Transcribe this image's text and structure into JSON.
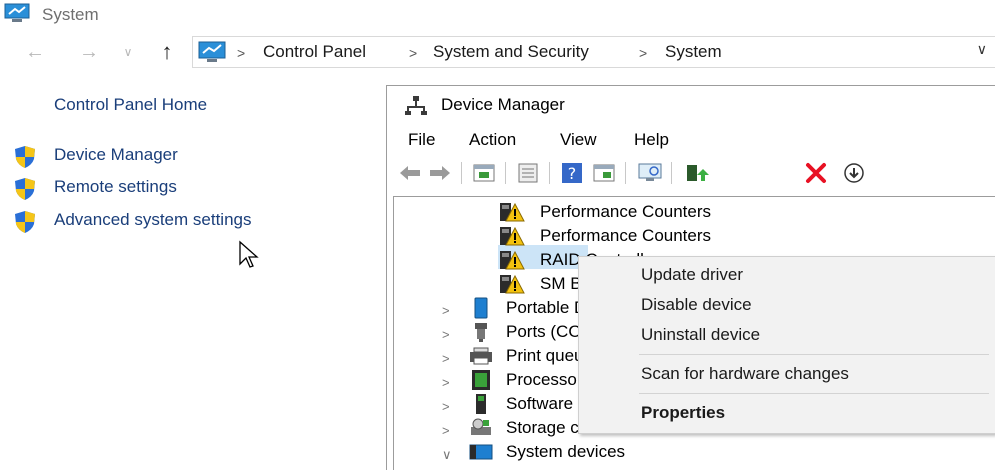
{
  "window": {
    "title": "System"
  },
  "nav": {
    "back_icon": "back-arrow-icon",
    "forward_icon": "forward-arrow-icon",
    "up_icon": "up-arrow-icon",
    "breadcrumbs": [
      "Control Panel",
      "System and Security",
      "System"
    ],
    "separator": ">"
  },
  "left_pane": {
    "home": "Control Panel Home",
    "links": [
      "Device Manager",
      "Remote settings",
      "Advanced system settings"
    ]
  },
  "device_manager": {
    "title": "Device Manager",
    "menu": [
      "File",
      "Action",
      "View",
      "Help"
    ],
    "tree": {
      "children": [
        "Performance Counters",
        "Performance Counters",
        "RAID Controller",
        "SM Bus Controller"
      ],
      "categories": [
        "Portable Devices",
        "Ports (COM & LPT)",
        "Print queues",
        "Processors",
        "Software devices",
        "Storage controllers",
        "System devices"
      ]
    }
  },
  "context_menu": {
    "items": [
      "Update driver",
      "Disable device",
      "Uninstall device"
    ],
    "scan": "Scan for hardware changes",
    "properties": "Properties"
  },
  "colors": {
    "link": "#1a3e7a",
    "selection": "#cce4f7",
    "menu_bg": "#f2f2f2",
    "delete_red": "#e81123"
  }
}
